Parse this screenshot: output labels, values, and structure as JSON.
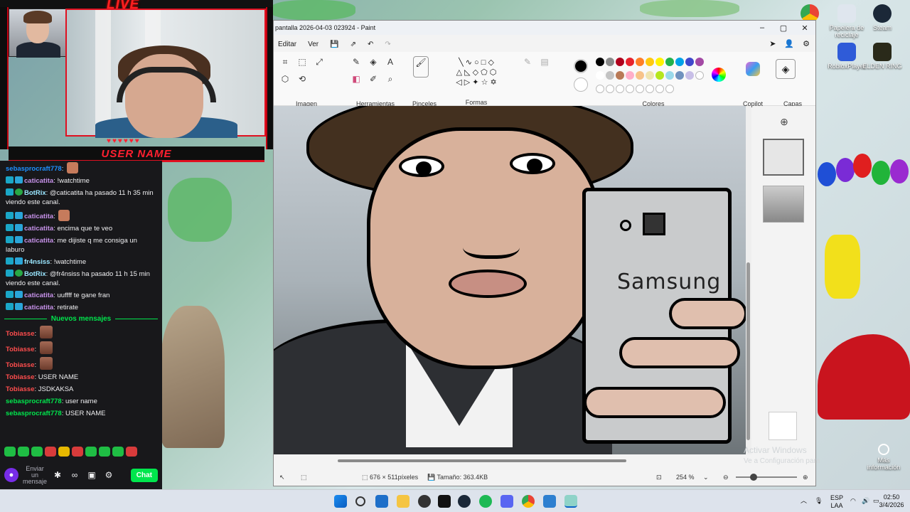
{
  "stream": {
    "live_label": "LIVE",
    "user_banner": "USER NAME",
    "hearts": "♥♥♥♥♥♥"
  },
  "chat": {
    "messages": [
      {
        "user": "sebasprocraft778",
        "color": "#1e90ff",
        "text": ""
      },
      {
        "user": "caticatita",
        "color": "#c792ea",
        "text": "!watchtime"
      },
      {
        "user": "BotRix",
        "color": "#9ae6ff",
        "text": "@caticatita ha pasado 11 h 35 min viendo este canal."
      },
      {
        "user": "caticatita",
        "color": "#c792ea",
        "text": ""
      },
      {
        "user": "caticatita",
        "color": "#c792ea",
        "text": "encima que te veo"
      },
      {
        "user": "caticatita",
        "color": "#c792ea",
        "text": "me dijiste q me consiga un laburo"
      },
      {
        "user": "fr4nsiss",
        "color": "#9ae6ff",
        "text": "!watchtime"
      },
      {
        "user": "BotRix",
        "color": "#9ae6ff",
        "text": "@fr4nsiss ha pasado 11 h 15 min viendo este canal."
      },
      {
        "user": "caticatita",
        "color": "#c792ea",
        "text": "uuffff te gane fran"
      },
      {
        "user": "caticatita",
        "color": "#c792ea",
        "text": "retirate"
      }
    ],
    "new_messages_label": "Nuevos mensajes",
    "new_messages": [
      {
        "user": "Tobiasse",
        "color": "#ff4d4d",
        "text": ""
      },
      {
        "user": "Tobiasse",
        "color": "#ff4d4d",
        "text": ""
      },
      {
        "user": "Tobiasse",
        "color": "#ff4d4d",
        "text": ""
      },
      {
        "user": "Tobiasse",
        "color": "#ff4d4d",
        "text": "USER NAME"
      },
      {
        "user": "Tobiasse",
        "color": "#ff4d4d",
        "text": "JSDKAKSA"
      },
      {
        "user": "sebasprocraft778",
        "color": "#00e64d",
        "text": "user name"
      },
      {
        "user": "sebasprocraft778",
        "color": "#00e64d",
        "text": "USER NAME"
      }
    ],
    "send_placeholder": "Enviar un mensaje",
    "chat_button": "Chat"
  },
  "paint": {
    "title": "pantalla 2026-04-03 023924 - Paint",
    "menu": [
      "Editar",
      "Ver"
    ],
    "groups": {
      "imagen": "Imagen",
      "herramientas": "Herramientas",
      "pinceles": "Pinceles",
      "formas": "Formas",
      "colores": "Colores",
      "copilot": "Copilot",
      "capas": "Capas"
    },
    "canvas_text": "Samsung",
    "status": {
      "dimensions": "676 × 511píxeles",
      "size": "Tamaño: 363.4KB",
      "zoom": "254 %"
    },
    "palette": [
      "#000000",
      "#8a8a8a",
      "#b0001c",
      "#e8232c",
      "#ff7f27",
      "#ffc90e",
      "#fff200",
      "#22b14c",
      "#00a2e8",
      "#3f48cc",
      "#a349a4",
      "#ffffff",
      "#c3c3c3",
      "#b97a57",
      "#ffaec9",
      "#f7c389",
      "#efe4b0",
      "#b5e61d",
      "#99d9ea",
      "#7092be",
      "#c8bfe7"
    ]
  },
  "desktop": {
    "icons": [
      "Papelera de reciclaje",
      "Steam",
      "RobloxPlayer",
      "ELDEN RING"
    ],
    "activate_line1": "Activar Windows",
    "activate_line2": "Ve a Configuración para",
    "more_info": "Más información"
  },
  "taskbar": {
    "lang_line1": "ESP",
    "lang_line2": "LAA",
    "time": "02:50",
    "date": "3/4/2026"
  }
}
